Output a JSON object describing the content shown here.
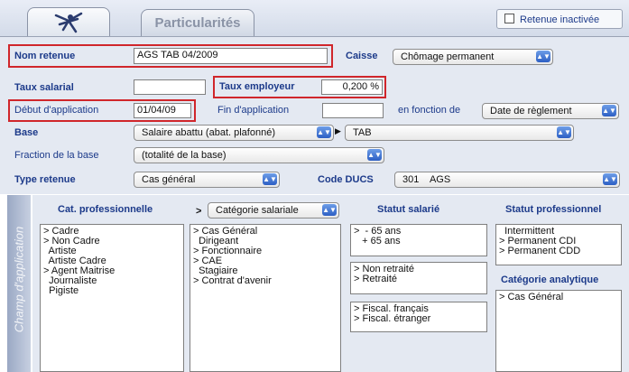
{
  "tabs": {
    "particularites": "Particularités"
  },
  "retenue_inactivee": "Retenue inactivée",
  "form": {
    "nom_retenue_label": "Nom retenue",
    "nom_retenue_value": "AGS TAB 04/2009",
    "caisse_label": "Caisse",
    "caisse_value": "Chômage permanent",
    "taux_salarial_label": "Taux salarial",
    "taux_salarial_value": "",
    "taux_employeur_label": "Taux employeur",
    "taux_employeur_value": "0,200 %",
    "debut_label": "Début d'application",
    "debut_value": "01/04/09",
    "fin_label": "Fin d'application",
    "fin_value": "",
    "en_fonction_label": "en fonction de",
    "en_fonction_value": "Date de règlement",
    "base_label": "Base",
    "base_value": "Salaire abattu (abat. plafonné)",
    "base_right_value": "TAB",
    "fraction_label": "Fraction de la base",
    "fraction_value": "(totalité de la base)",
    "type_label": "Type retenue",
    "type_value": "Cas général",
    "ducs_label": "Code DUCS",
    "ducs_value": "301    AGS"
  },
  "sidebar_label": "Champ d'application",
  "panel": {
    "cat_pro_header": "Cat. professionnelle",
    "cat_pro_items": [
      "> Cadre",
      "> Non Cadre",
      "  Artiste",
      "  Artiste Cadre",
      "> Agent Maitrise",
      "  Journaliste",
      "  Pigiste"
    ],
    "cat_sal_prefix": ">",
    "cat_sal_select": "Catégorie salariale",
    "cat_sal_items": [
      "> Cas Général",
      "  Dirigeant",
      "> Fonctionnaire",
      "> CAE",
      "  Stagiaire",
      "> Contrat d'avenir"
    ],
    "statut_sal_header": "Statut salarié",
    "age_items": [
      ">  - 65 ans",
      "   + 65 ans"
    ],
    "retraite_items": [
      "> Non retraité",
      "> Retraité"
    ],
    "fiscal_items": [
      "> Fiscal. français",
      "> Fiscal. étranger"
    ],
    "statut_pro_header": "Statut professionnel",
    "statut_pro_items": [
      "  Intermittent",
      "> Permanent CDI",
      "> Permanent CDD"
    ],
    "cat_analytique_header": "Catégorie analytique",
    "cat_analytique_items": [
      "> Cas Général"
    ]
  }
}
